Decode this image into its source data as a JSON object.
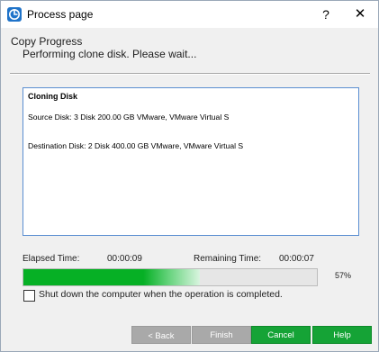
{
  "window": {
    "title": "Process page",
    "help_symbol": "?",
    "close_symbol": "✕"
  },
  "header": {
    "heading": "Copy Progress",
    "subheading": "Performing clone disk. Please wait..."
  },
  "log": {
    "title": "Cloning Disk",
    "lines": [
      "Source Disk: 3 Disk 200.00 GB VMware, VMware Virtual S",
      "Destination Disk: 2 Disk 400.00 GB VMware, VMware Virtual S"
    ]
  },
  "progress": {
    "elapsed_label": "Elapsed Time:",
    "elapsed_value": "00:00:09",
    "remaining_label": "Remaining Time:",
    "remaining_value": "00:00:07",
    "percent_text": "57%",
    "fraction": 0.6
  },
  "shutdown": {
    "label": "Shut down the computer when the operation is completed.",
    "checked": false
  },
  "buttons": {
    "back": "Back",
    "back_chevron": "<",
    "finish": "Finish",
    "cancel": "Cancel",
    "help": "Help"
  },
  "colors": {
    "progress_green": "#06b025",
    "button_green": "#15a336",
    "button_disabled": "#a9a9a9"
  }
}
